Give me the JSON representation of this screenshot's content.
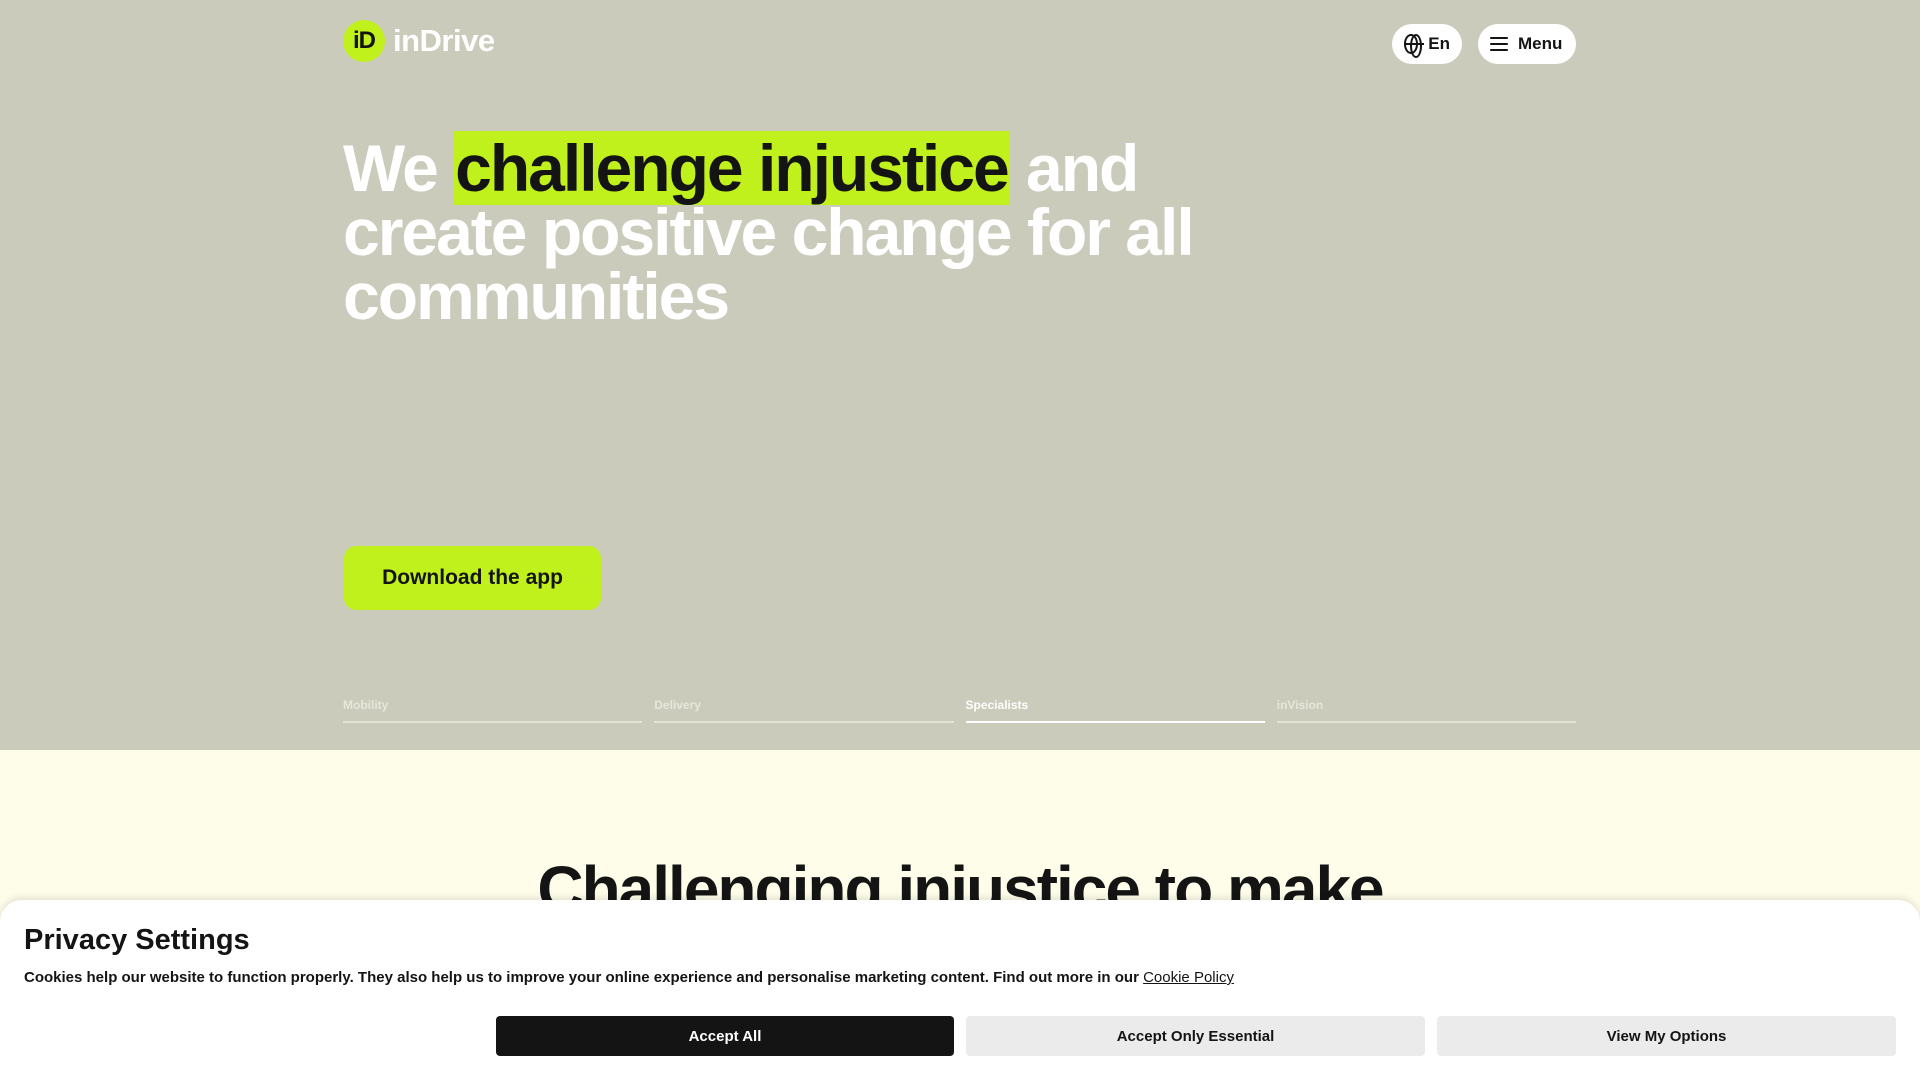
{
  "header": {
    "logo_mark": "iD",
    "logo_text": "inDrive",
    "lang_label": "En",
    "menu_label": "Menu"
  },
  "hero": {
    "headline_pre": "We ",
    "headline_highlight": "challenge injustice",
    "headline_post": " and create positive change for all communities",
    "cta_label": "Download the app",
    "tabs": [
      "Mobility",
      "Delivery",
      "Specialists",
      "inVision"
    ],
    "active_tab": "Specialists"
  },
  "section2": {
    "title": "Challenging injustice to make"
  },
  "cookie_banner": {
    "title": "Privacy Settings",
    "text": "Cookies help our website to function properly. They also help us to improve your online experience and personalise marketing content. Find out more in our ",
    "link_label": "Cookie Policy",
    "buttons": {
      "accept_all": "Accept All",
      "accept_essential": "Accept Only Essential",
      "view_options": "View My Options"
    }
  },
  "colors": {
    "hero_bg": "#cbcbbb",
    "accent": "#c1f11d",
    "page_bg": "#fdfde9",
    "text_dark": "#141414"
  },
  "icons": [
    "globe-icon",
    "menu-icon"
  ]
}
